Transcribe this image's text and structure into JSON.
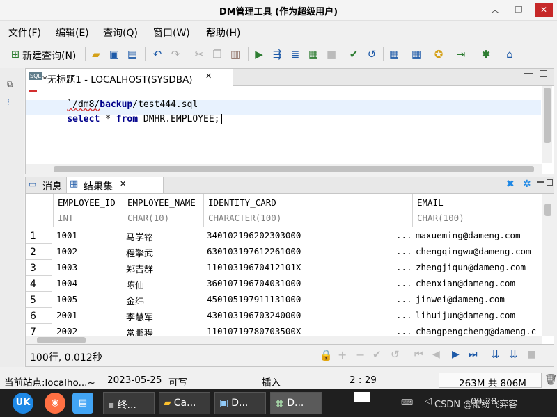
{
  "window": {
    "title": "DM管理工具 (作为超级用户)",
    "minimize_icon": "︿",
    "restore_icon": "❐",
    "close_icon": "✕"
  },
  "menubar": {
    "items": [
      "文件(F)",
      "编辑(E)",
      "查询(Q)",
      "窗口(W)",
      "帮助(H)"
    ]
  },
  "toolbar": {
    "new_query_label": "新建查询(N)"
  },
  "editor": {
    "tab_label": "*无标题1 - LOCALHOST(SYSDBA)",
    "tab_close_icon": "✕",
    "line1": "`/dm8/backup/test444.sql",
    "line1_path_prefix": "`/dm8/",
    "line1_keyword": "backup",
    "line1_suffix": "/test444.sql",
    "line2_kw1": "select",
    "line2_mid": " * ",
    "line2_kw2": "from",
    "line2_rest": " DMHR.EMPLOYEE;"
  },
  "results": {
    "tab_messages": "消息",
    "tab_resultset": "结果集",
    "tab_close_icon": "✕",
    "columns": [
      {
        "name": "EMPLOYEE_ID",
        "type": "INT"
      },
      {
        "name": "EMPLOYEE_NAME",
        "type": "CHAR(10)"
      },
      {
        "name": "IDENTITY_CARD",
        "type": "CHARACTER(100)"
      },
      {
        "name": "EMAIL",
        "type": "CHAR(100)"
      }
    ],
    "rows": [
      {
        "n": "1",
        "id": "1001",
        "name": "马学铭",
        "card": "340102196202303000",
        "email": "maxueming@dameng.com"
      },
      {
        "n": "2",
        "id": "1002",
        "name": "程擎武",
        "card": "630103197612261000",
        "email": "chengqingwu@dameng.com"
      },
      {
        "n": "3",
        "id": "1003",
        "name": "郑吉群",
        "card": "11010319670412101X",
        "email": "zhengjiqun@dameng.com"
      },
      {
        "n": "4",
        "id": "1004",
        "name": "陈仙",
        "card": "360107196704031000",
        "email": "chenxian@dameng.com"
      },
      {
        "n": "5",
        "id": "1005",
        "name": "金纬",
        "card": "450105197911131000",
        "email": "jinwei@dameng.com"
      },
      {
        "n": "6",
        "id": "2001",
        "name": "李慧军",
        "card": "430103196703240000",
        "email": "lihuijun@dameng.com"
      },
      {
        "n": "7",
        "id": "2002",
        "name": "常鹏程",
        "card": "11010719780703500X",
        "email": "changpengcheng@dameng.c"
      }
    ],
    "ellipsis": "...",
    "summary": "100行, 0.012秒"
  },
  "statusbar": {
    "site": "当前站点:localho...~",
    "date": "2023-05-25",
    "mode": "可写",
    "insert": "插入",
    "position": "2 : 29",
    "memory": "263M 共 806M"
  },
  "taskbar": {
    "launcher1": "UK",
    "terminal": "终...",
    "files": "Ca...",
    "app1": "D...",
    "app2": "D...",
    "tray_text": "CSDN @雨纷飞弈客",
    "time": "09:28"
  }
}
